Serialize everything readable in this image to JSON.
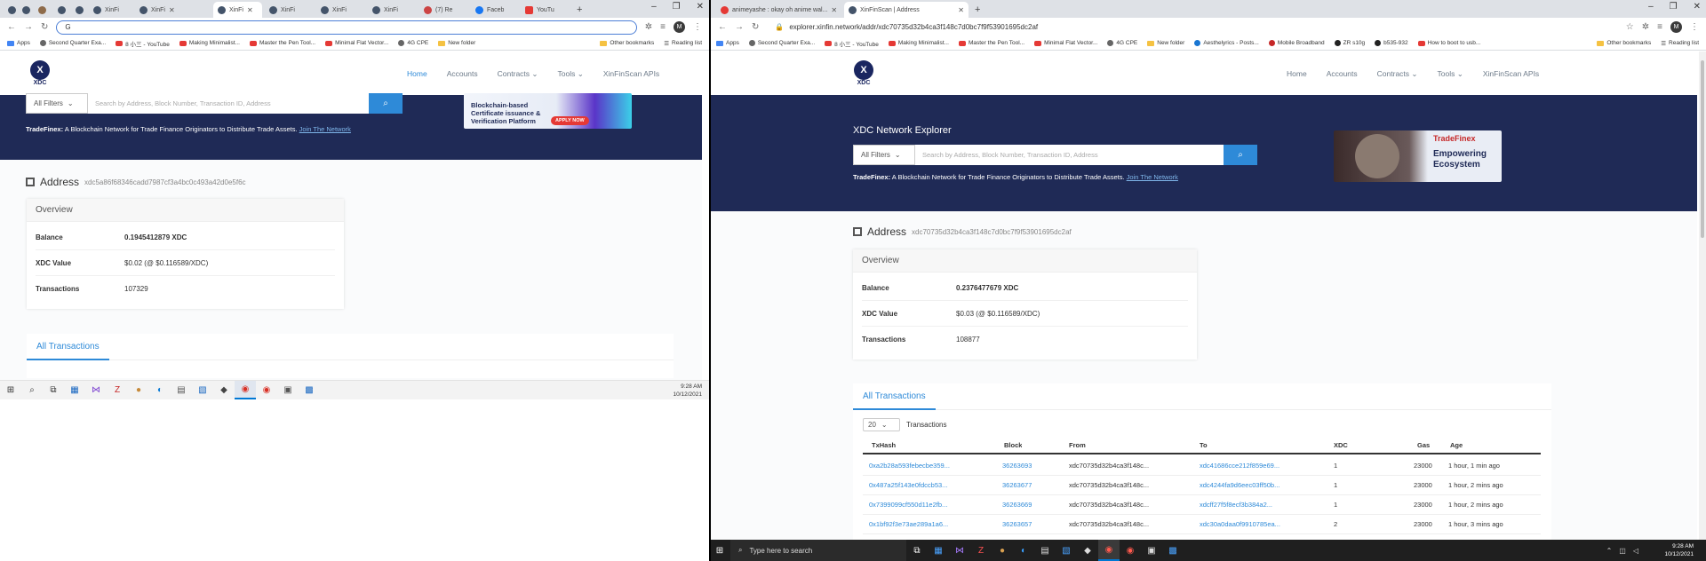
{
  "left": {
    "tabs": [
      {
        "label": ""
      },
      {
        "label": ""
      },
      {
        "label": ""
      },
      {
        "label": ""
      },
      {
        "label": ""
      },
      {
        "label": "XinFi"
      },
      {
        "label": "XinFi"
      },
      {
        "label": "XinFi"
      },
      {
        "label": "XinFi"
      },
      {
        "label": "XinFi"
      },
      {
        "label": "XinFi"
      },
      {
        "label": "(7) Re"
      },
      {
        "label": "Faceb"
      },
      {
        "label": "YouTu"
      }
    ],
    "address_bar": "G",
    "bookmarks": [
      "Apps",
      "Second Quarter Exa...",
      "8 小三 - YouTube",
      "Making Minimalist...",
      "Master the Pen Tool...",
      "Minimal Flat Vector...",
      "4G CPE",
      "New folder",
      "Other bookmarks",
      "Reading list"
    ],
    "nav": [
      "Home",
      "Accounts",
      "Contracts",
      "Tools",
      "XinFinScan APIs"
    ],
    "logo_text": "XDC",
    "search": {
      "filter": "All Filters",
      "placeholder": "Search by Address, Block Number, Transaction ID, Address"
    },
    "tagline": {
      "brand": "TradeFinex:",
      "text": "A Blockchain Network for Trade Finance Originators to Distribute Trade Assets.",
      "link": "Join The Network"
    },
    "ad": {
      "line1": "Blockchain-based",
      "line2": "Certificate issuance &",
      "line3": "Verification Platform",
      "cta": "APPLY NOW"
    },
    "address_label": "Address",
    "address_hash": "xdc5a86f68346cadd7987cf3a4bc0c493a42d0e5f6c",
    "overview_title": "Overview",
    "rows": [
      {
        "label": "Balance",
        "value": "0.1945412879 XDC"
      },
      {
        "label": "XDC Value",
        "value": "$0.02 (@ $0.116589/XDC)"
      },
      {
        "label": "Transactions",
        "value": "107329"
      }
    ],
    "tx_tab": "All Transactions",
    "taskbar_time": "9:28 AM",
    "taskbar_date": "10/12/2021"
  },
  "right": {
    "tabs": [
      {
        "label": "animeyashe : okay oh anime wal..."
      },
      {
        "label": "XinFinScan | Address"
      }
    ],
    "url": "explorer.xinfin.network/addr/xdc70735d32b4ca3f148c7d0bc7f9f53901695dc2af",
    "bookmarks": [
      "Apps",
      "Second Quarter Exa...",
      "8 小三 - YouTube",
      "Making Minimalist...",
      "Master the Pen Tool...",
      "Minimal Flat Vector...",
      "4G CPE",
      "New folder",
      "Aesthelyrics - Posts...",
      "Mobile Broadband",
      "ZR s10g",
      "b535-932",
      "How to boot to usb...",
      "Other bookmarks",
      "Reading list"
    ],
    "nav": [
      "Home",
      "Accounts",
      "Contracts",
      "Tools",
      "XinFinScan APIs"
    ],
    "logo_text": "XDC",
    "hero_title": "XDC Network Explorer",
    "search": {
      "filter": "All Filters",
      "placeholder": "Search by Address, Block Number, Transaction ID, Address"
    },
    "tagline": {
      "brand": "TradeFinex:",
      "text": "A Blockchain Network for Trade Finance Originators to Distribute Trade Assets.",
      "link": "Join The Network"
    },
    "ad": {
      "brand": "TradeFinex",
      "line1": "Empowering",
      "line2": "Ecosystem"
    },
    "address_label": "Address",
    "address_hash": "xdc70735d32b4ca3f148c7d0bc7f9f53901695dc2af",
    "overview_title": "Overview",
    "rows": [
      {
        "label": "Balance",
        "value": "0.2376477679 XDC"
      },
      {
        "label": "XDC Value",
        "value": "$0.03 (@ $0.116589/XDC)"
      },
      {
        "label": "Transactions",
        "value": "108877"
      }
    ],
    "tx_tab": "All Transactions",
    "page_size": "20",
    "page_size_label": "Transactions",
    "columns": [
      "TxHash",
      "Block",
      "From",
      "To",
      "XDC",
      "Gas",
      "Age"
    ],
    "tx_rows": [
      {
        "hash": "0xa2b28a593febecbe359...",
        "block": "36263693",
        "from": "xdc70735d32b4ca3f148c...",
        "to": "xdc41686cce212f859e69...",
        "xdc": "1",
        "gas": "23000",
        "age": "1 hour, 1 min ago"
      },
      {
        "hash": "0x487a25f143e0fdccb53...",
        "block": "36263677",
        "from": "xdc70735d32b4ca3f148c...",
        "to": "xdc4244fa9d6eec03ff50b...",
        "xdc": "1",
        "gas": "23000",
        "age": "1 hour, 2 mins ago"
      },
      {
        "hash": "0x7399099cf550d11e2fb...",
        "block": "36263669",
        "from": "xdc70735d32b4ca3f148c...",
        "to": "xdcff27f5f8ecf3b384a2...",
        "xdc": "1",
        "gas": "23000",
        "age": "1 hour, 2 mins ago"
      },
      {
        "hash": "0x1bf92f3e73ae289a1a6...",
        "block": "36263657",
        "from": "xdc70735d32b4ca3f148c...",
        "to": "xdc30a0daa0f9910785ea...",
        "xdc": "2",
        "gas": "23000",
        "age": "1 hour, 3 mins ago"
      }
    ],
    "taskbar_search": "Type here to search",
    "taskbar_time": "9:28 AM",
    "taskbar_date": "10/12/2021"
  }
}
